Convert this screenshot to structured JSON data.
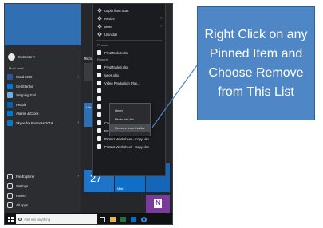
{
  "callout": {
    "text": "Right Click on any Pinned Item and Choose Remove from This List"
  },
  "start_menu": {
    "user_name": "Instructor A",
    "most_used_label": "Most used",
    "apps": [
      {
        "label": "Word 2016",
        "icon": "word-icon",
        "color": "#2b579a",
        "has_arrow": true
      },
      {
        "label": "Get Started",
        "icon": "lightbulb-icon",
        "color": "#0078d7",
        "has_arrow": false
      },
      {
        "label": "Snipping Tool",
        "icon": "scissors-icon",
        "color": "#6bb0e8",
        "has_arrow": false
      },
      {
        "label": "People",
        "icon": "people-icon",
        "color": "#0063b1",
        "has_arrow": false
      },
      {
        "label": "Alarms & Clock",
        "icon": "clock-icon",
        "color": "#0078d7",
        "has_arrow": false
      },
      {
        "label": "Skype for Business 2016",
        "icon": "skype-icon",
        "color": "#0a7bc6",
        "has_arrow": true
      }
    ],
    "bottom_items": [
      {
        "label": "File Explorer",
        "icon": "folder-icon",
        "has_arrow": true
      },
      {
        "label": "Settings",
        "icon": "gear-icon",
        "has_arrow": false
      },
      {
        "label": "Power",
        "icon": "power-icon",
        "has_arrow": false
      },
      {
        "label": "All apps",
        "icon": "list-icon",
        "has_arrow": false
      }
    ]
  },
  "tiles": {
    "header_left": "Micro",
    "header_right": "Pla",
    "life_label": "Life at",
    "calendar_day": "27",
    "mail_label": "Mail",
    "onenote_label": "N"
  },
  "jump_list": {
    "top_items": [
      {
        "label": "Unpin from Start",
        "has_chevron": false
      },
      {
        "label": "Resize",
        "has_chevron": true
      },
      {
        "label": "More",
        "has_chevron": true
      },
      {
        "label": "Uninstall",
        "has_chevron": false
      }
    ],
    "pinned_header": "Pinned",
    "pinned": [
      "PivotTable3.xlsx"
    ],
    "recent_header": "Recent",
    "recent": [
      "PivotTable3.xlsx",
      "sales.xlsx",
      "Video Production Plan...",
      "",
      "",
      "",
      "",
      "Comments.xlsx",
      "Protect Worksheet - Copy",
      "Protect Worksheet - Copy.xlsx",
      "Protect Worksheet - Copy.xlsx"
    ]
  },
  "context_menu": {
    "items": [
      "Open",
      "Pin to this list",
      "Remove from this list"
    ]
  },
  "taskbar": {
    "search_placeholder": "Ask me anything"
  }
}
